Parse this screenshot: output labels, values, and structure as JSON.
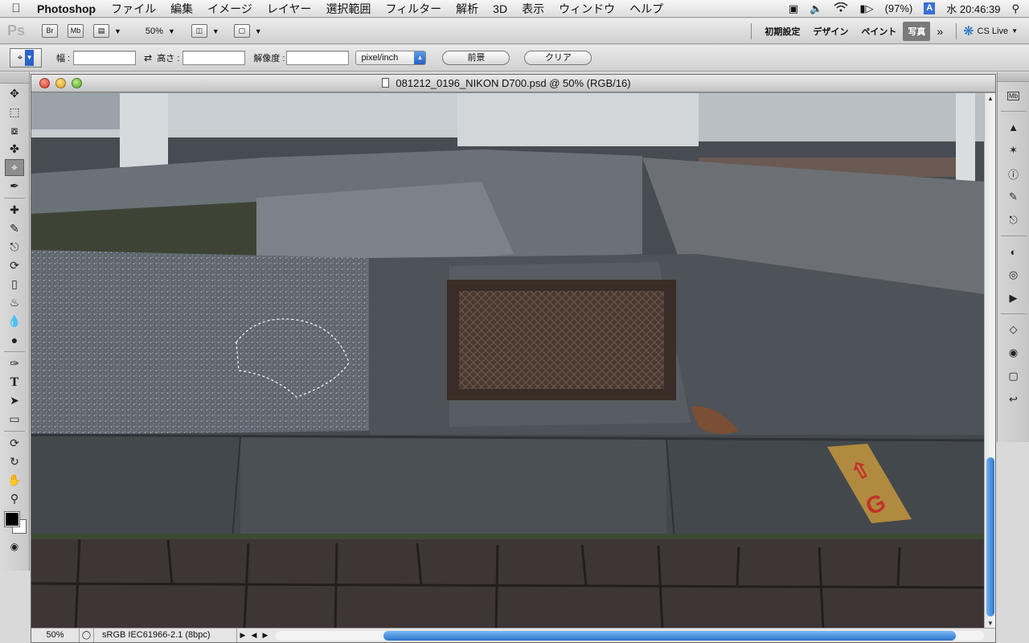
{
  "menubar": {
    "app_name": "Photoshop",
    "menus": [
      "ファイル",
      "編集",
      "イメージ",
      "レイヤー",
      "選択範囲",
      "フィルター",
      "解析",
      "3D",
      "表示",
      "ウィンドウ",
      "ヘルプ"
    ],
    "battery": "(97%)",
    "input_method": "A",
    "clock": "水 20:46:39"
  },
  "appbar": {
    "logo": "Ps",
    "bridge": "Br",
    "minibridge": "Mb",
    "zoom": "50%",
    "workspaces": [
      "初期設定",
      "デザイン",
      "ペイント"
    ],
    "active_workspace": "写真",
    "more": "»",
    "cs_live": "CS Live"
  },
  "options": {
    "width_label": "幅 :",
    "width_value": "",
    "height_label": "高さ :",
    "height_value": "",
    "resolution_label": "解像度 :",
    "resolution_value": "",
    "unit": "pixel/inch",
    "front_button": "前景",
    "clear_button": "クリア"
  },
  "document": {
    "title": "081212_0196_NIKON D700.psd @ 50% (RGB/16)",
    "zoom": "50%",
    "profile": "sRGB IEC61966-2.1 (8bpc)"
  },
  "colors": {
    "foreground": "#000000",
    "background": "#ffffff",
    "scroll_accent": "#2f79d0"
  }
}
